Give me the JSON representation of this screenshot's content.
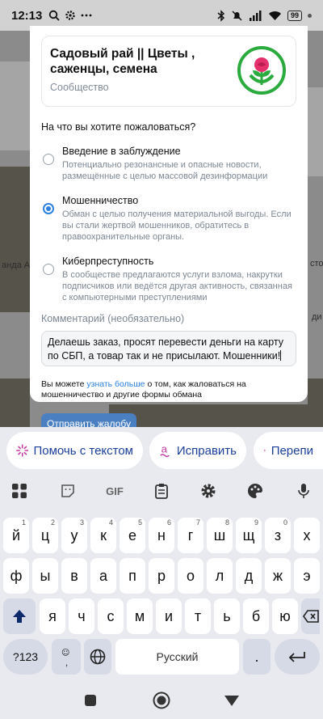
{
  "status_bar": {
    "time": "12:13",
    "battery": "99",
    "icons": [
      "search-icon",
      "gear-icon",
      "dots-icon",
      "bluetooth-icon",
      "mute-icon",
      "signal-icon",
      "wifi-icon",
      "battery-icon",
      "dot-icon"
    ]
  },
  "background": {
    "side_text_1": "анда Ай",
    "side_text_2": "сто",
    "side_text_3": "ди"
  },
  "dialog": {
    "community_title": "Садовый рай || Цветы , саженцы, семена",
    "community_subtitle": "Сообщество",
    "question": "На что вы хотите пожаловаться?",
    "options": [
      {
        "title": "Введение в заблуждение",
        "description": "Потенциально резонансные и опасные новости, размещённые с целью массовой дезинформации",
        "selected": false
      },
      {
        "title": "Мошенничество",
        "description": "Обман с целью получения материальной выгоды. Если вы стали жертвой мошенников, обратитесь в правоохранительные органы.",
        "selected": true
      },
      {
        "title": "Киберпреступность",
        "description": "В сообществе предлагаются услуги взлома, накрутки подписчиков или ведётся другая активность, связанная с компьютерными преступлениями",
        "selected": false
      }
    ],
    "comment_label": "Комментарий (необязательно)",
    "comment_value": "Делаешь заказ, просят перевести деньги на карту по СБП, а товар так и не присылают. Мошенники!",
    "hint_before": "Вы можете ",
    "hint_link": "узнать больше",
    "hint_after": " о том, как жаловаться на мошенничество и другие формы обмана",
    "submit_label": "Отправить жалобу"
  },
  "keyboard": {
    "suggestions": [
      "Помочь с текстом",
      "Исправить",
      "Перепи"
    ],
    "suggestion_icons": [
      "sparkle-icon",
      "spellcheck-icon",
      "sparkle-icon"
    ],
    "tools": [
      "apps-grid-icon",
      "sticker-icon",
      "GIF",
      "clipboard-icon",
      "gear-icon",
      "palette-icon",
      "mic-icon"
    ],
    "row1": [
      "й",
      "ц",
      "у",
      "к",
      "е",
      "н",
      "г",
      "ш",
      "щ",
      "з",
      "х"
    ],
    "row1_nums": [
      "1",
      "2",
      "3",
      "4",
      "5",
      "6",
      "7",
      "8",
      "9",
      "0",
      ""
    ],
    "row2": [
      "ф",
      "ы",
      "в",
      "а",
      "п",
      "р",
      "о",
      "л",
      "д",
      "ж",
      "э"
    ],
    "row3": [
      "я",
      "ч",
      "с",
      "м",
      "и",
      "т",
      "ь",
      "б",
      "ю"
    ],
    "symbols_label": "?123",
    "space_label": "Русский",
    "period_label": "."
  },
  "nav_bar": {
    "icons": [
      "recents-icon",
      "home-icon",
      "back-icon"
    ]
  },
  "colors": {
    "accent": "#2d81e0",
    "button": "#4a7fc1",
    "logo_green": "#2bab3d",
    "suggestion_text": "#1b3f9a"
  }
}
